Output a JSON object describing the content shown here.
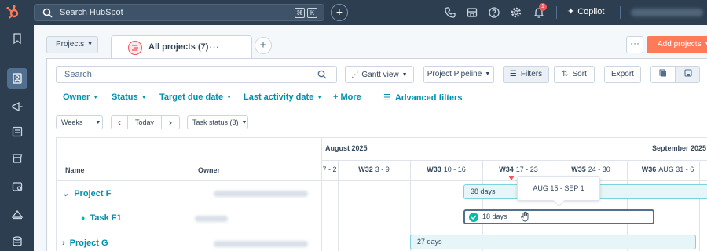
{
  "topbar": {
    "search_placeholder": "Search HubSpot",
    "kbd_cmd": "⌘",
    "kbd_k": "K",
    "add_label": "+",
    "notification_count": "1",
    "copilot_label": "Copilot",
    "copilot_icon": "sparkle-icon",
    "icons": [
      "phone-icon",
      "marketplace-icon",
      "help-icon",
      "settings-icon",
      "bell-icon"
    ]
  },
  "leftnav": {
    "icons": [
      "bookmark-icon",
      "contacts-icon",
      "marketing-icon",
      "content-icon",
      "commerce-icon",
      "service-icon",
      "automation-icon",
      "data-icon"
    ],
    "active_index": 1
  },
  "subheader": {
    "projects_select": "Projects",
    "tab_title": "All projects (7)",
    "tab_more": "···",
    "add_tab": "+",
    "more": "···",
    "add_projects": "Add projects"
  },
  "toolbar": {
    "search_placeholder": "Search",
    "gantt_view": "Gantt view",
    "pipeline": "Project Pipeline",
    "filters": "Filters",
    "sort": "Sort",
    "export": "Export"
  },
  "filters": {
    "owner": "Owner",
    "status": "Status",
    "target_due_date": "Target due date",
    "last_activity_date": "Last activity date",
    "more": "+ More",
    "advanced": "Advanced filters"
  },
  "controls": {
    "period": "Weeks",
    "prev": "‹",
    "today": "Today",
    "next": "›",
    "task_status": "Task status (3)"
  },
  "gantt": {
    "months": [
      "August 2025",
      "September 2025"
    ],
    "col_name": "Name",
    "col_owner": "Owner",
    "weeks": [
      {
        "label": "",
        "range": "7 - 2"
      },
      {
        "label": "W32",
        "range": "3 - 9"
      },
      {
        "label": "W33",
        "range": "10 - 16"
      },
      {
        "label": "W34",
        "range": "17 - 23"
      },
      {
        "label": "W35",
        "range": "24 - 30"
      },
      {
        "label": "W36",
        "range": "AUG 31 - 6"
      }
    ],
    "rows": [
      {
        "name": "Project F",
        "type": "project",
        "bar_label": "38 days"
      },
      {
        "name": "Task F1",
        "type": "task",
        "bar_label": "18 days"
      },
      {
        "name": "Project G",
        "type": "project",
        "bar_label": "27 days"
      }
    ],
    "tooltip": "AUG 15 - SEP 1"
  },
  "colors": {
    "topbar": "#2d3e50",
    "accent": "#0091ae",
    "cta": "#ff7a59",
    "task_check": "#00bda5",
    "today_marker": "#f2545b"
  }
}
